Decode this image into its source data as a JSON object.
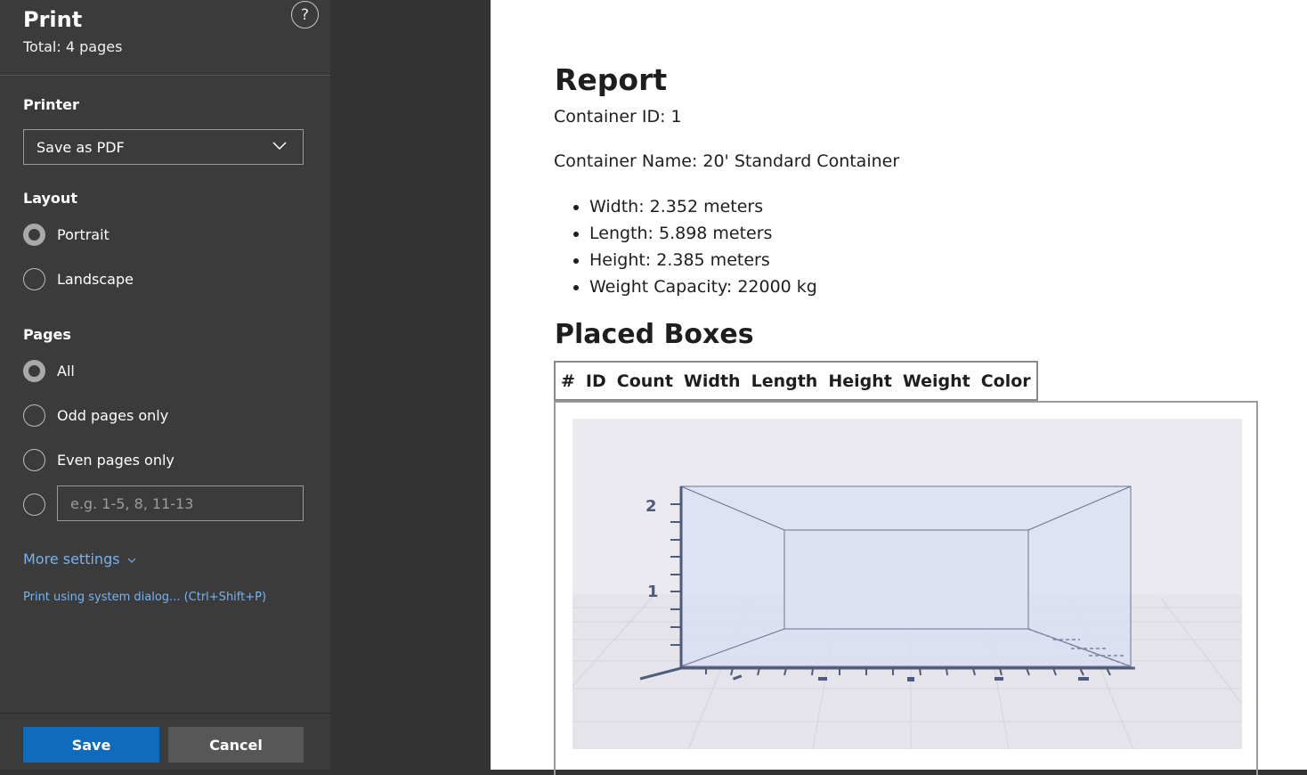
{
  "print_panel": {
    "title": "Print",
    "total": "Total: 4 pages",
    "help_symbol": "?",
    "printer": {
      "label": "Printer",
      "selected": "Save as PDF"
    },
    "layout": {
      "label": "Layout",
      "options": [
        {
          "label": "Portrait",
          "checked": true
        },
        {
          "label": "Landscape",
          "checked": false
        }
      ]
    },
    "pages": {
      "label": "Pages",
      "options": [
        {
          "label": "All",
          "checked": true
        },
        {
          "label": "Odd pages only",
          "checked": false
        },
        {
          "label": "Even pages only",
          "checked": false
        }
      ],
      "custom_placeholder": "e.g. 1-5, 8, 11-13"
    },
    "more_settings": "More settings",
    "system_dialog": "Print using system dialog... (Ctrl+Shift+P)",
    "save_label": "Save",
    "cancel_label": "Cancel",
    "colors": {
      "panel": "#3b3b3b",
      "accent": "#0f6cbd",
      "link": "#79b2ee"
    }
  },
  "report": {
    "title": "Report",
    "container_id": "Container ID: 1",
    "container_name": "Container Name: 20' Standard Container",
    "specs": [
      "Width: 2.352 meters",
      "Length: 5.898 meters",
      "Height: 2.385 meters",
      "Weight Capacity: 22000 kg"
    ],
    "placed_boxes_title": "Placed Boxes",
    "table_headers": [
      "#",
      "ID",
      "Count",
      "Width",
      "Length",
      "Height",
      "Weight",
      "Color"
    ],
    "chart": {
      "type": "3d-box",
      "z_tick_labels": [
        "1",
        "2"
      ]
    }
  }
}
